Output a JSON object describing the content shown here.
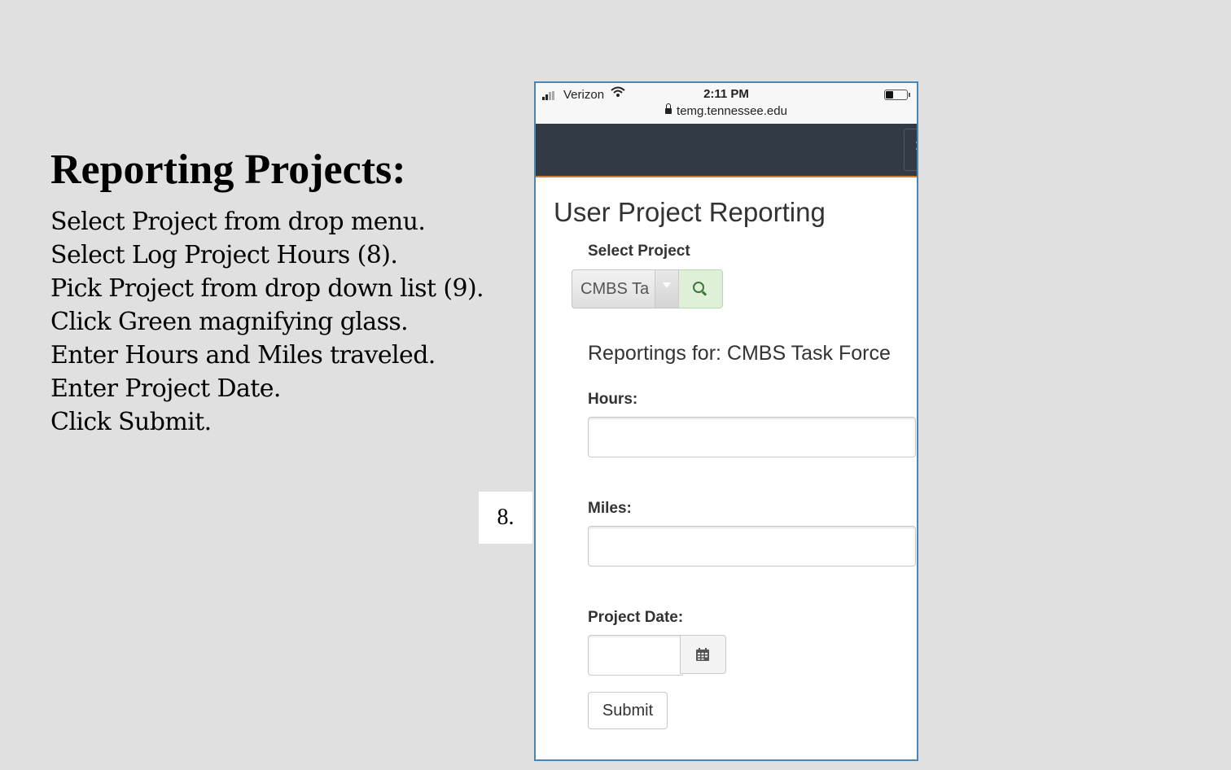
{
  "slide": {
    "title": "Reporting Projects:",
    "steps": [
      "Select Project from drop menu.",
      "Select Log Project Hours (8).",
      "Pick Project from drop down list (9).",
      "Click Green magnifying glass.",
      "Enter Hours and Miles traveled.",
      "Enter Project Date.",
      "Click Submit."
    ],
    "callout_label": "8."
  },
  "phone": {
    "status_bar": {
      "carrier": "Verizon",
      "time": "2:11 PM",
      "url": "temg.tennessee.edu",
      "battery_level": 0.35
    },
    "page_title": "User Project Reporting",
    "select_project": {
      "label": "Select Project",
      "selected_value": "CMBS Ta"
    },
    "reportings_heading": "Reportings for: CMBS Task Force",
    "hours": {
      "label": "Hours:",
      "value": ""
    },
    "miles": {
      "label": "Miles:",
      "value": ""
    },
    "project_date": {
      "label": "Project Date:",
      "value": ""
    },
    "submit_label": "Submit"
  },
  "colors": {
    "navbar": "#323b45",
    "navbar_accent": "#d67b2a",
    "search_button_bg": "#dff0d8",
    "search_icon": "#3c763d",
    "phone_border": "#4a86b4"
  },
  "icons": [
    "signal-icon",
    "wifi-icon",
    "lock-icon",
    "battery-icon",
    "menu-toggle",
    "search-icon",
    "calendar-icon"
  ]
}
